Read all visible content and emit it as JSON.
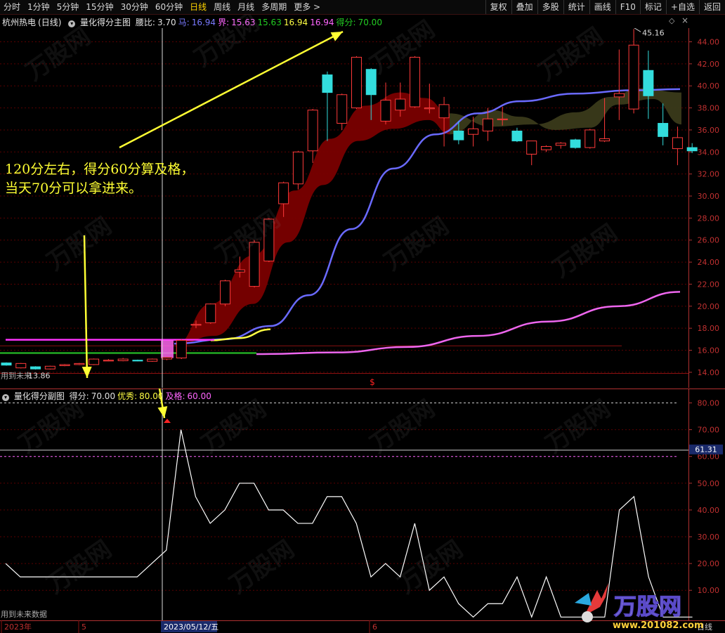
{
  "toolbar": {
    "periods": [
      "分时",
      "1分钟",
      "5分钟",
      "15分钟",
      "30分钟",
      "60分钟",
      "日线",
      "周线",
      "月线",
      "多周期",
      "更多 >"
    ],
    "active_period": "日线",
    "buttons": [
      "复权",
      "叠加",
      "多股",
      "统计",
      "画线",
      "F10",
      "标记",
      "+自选",
      "返回"
    ]
  },
  "main_panel": {
    "stock": "杭州热电",
    "period_label": "(日线)",
    "indicator": "量化得分主图",
    "legend": [
      {
        "k": "腰比",
        "v": "3.70",
        "color": "#e0e0e0"
      },
      {
        "k": "马",
        "v": "16.94",
        "color": "#7a7aff"
      },
      {
        "k": "界",
        "v": "15.63",
        "color": "#ff66ff"
      },
      {
        "k": "",
        "v": "15.63",
        "color": "#22cc22"
      },
      {
        "k": "",
        "v": "16.94",
        "color": "#ffff44"
      },
      {
        "k": "",
        "v": "16.94",
        "color": "#ff66ff"
      },
      {
        "k": "得分",
        "v": "70.00",
        "color": "#22cc22"
      }
    ],
    "y_ticks": [
      "44.00",
      "42.00",
      "40.00",
      "38.00",
      "36.00",
      "34.00",
      "32.00",
      "30.00",
      "28.00",
      "26.00",
      "24.00",
      "22.00",
      "20.00",
      "18.00",
      "16.00",
      "14.00"
    ],
    "high_label": "45.16",
    "low_label": "13.86",
    "future_note": "用到未来",
    "s_marker": "$"
  },
  "sub_panel": {
    "indicator": "量化得分副图",
    "legend": [
      {
        "k": "得分",
        "v": "70.00",
        "color": "#e0e0e0"
      },
      {
        "k": "优秀",
        "v": "80.00",
        "color": "#ffff44"
      },
      {
        "k": "及格",
        "v": "60.00",
        "color": "#ff66ff"
      }
    ],
    "y_ticks": [
      "80.00",
      "70.00",
      "60.00",
      "50.00",
      "40.00",
      "30.00",
      "20.00",
      "10.00"
    ],
    "cursor_value": "61.31",
    "future_note": "用到未来数据"
  },
  "x_axis": {
    "labels": [
      "2023年",
      "5",
      "6"
    ],
    "cursor_date": "2023/05/12/五",
    "period_tag": "日线"
  },
  "annotation": {
    "line1": "120分左右，得分60分算及格，",
    "line2": "当天70分可以拿进来。"
  },
  "watermark": {
    "brand": "万股网",
    "url": "www.201082.com"
  },
  "candles": [
    {
      "o": 14.85,
      "c": 14.65,
      "h": 14.9,
      "l": 14.6
    },
    {
      "o": 14.4,
      "c": 14.8,
      "h": 14.85,
      "l": 14.35
    },
    {
      "o": 14.5,
      "c": 14.3,
      "h": 14.55,
      "l": 14.25
    },
    {
      "o": 14.3,
      "c": 14.55,
      "h": 14.6,
      "l": 14.25
    },
    {
      "o": 14.6,
      "c": 14.7,
      "h": 14.75,
      "l": 14.55
    },
    {
      "o": 14.7,
      "c": 14.8,
      "h": 14.85,
      "l": 14.65
    },
    {
      "o": 14.7,
      "c": 15.2,
      "h": 15.25,
      "l": 14.65
    },
    {
      "o": 15.1,
      "c": 15.1,
      "h": 15.2,
      "l": 15.0
    },
    {
      "o": 15.05,
      "c": 15.2,
      "h": 15.3,
      "l": 15.0
    },
    {
      "o": 15.1,
      "c": 15.05,
      "h": 15.15,
      "l": 15.0
    },
    {
      "o": 15.0,
      "c": 15.2,
      "h": 15.25,
      "l": 14.95
    },
    {
      "o": 15.2,
      "c": 15.35,
      "h": 15.4,
      "l": 15.1
    },
    {
      "o": 15.3,
      "c": 16.9,
      "h": 17.0,
      "l": 15.2
    },
    {
      "o": 18.3,
      "c": 18.35,
      "h": 18.7,
      "l": 18.0
    },
    {
      "o": 18.5,
      "c": 20.2,
      "h": 20.25,
      "l": 18.4
    },
    {
      "o": 20.2,
      "c": 22.3,
      "h": 22.4,
      "l": 20.0
    },
    {
      "o": 23.1,
      "c": 23.3,
      "h": 24.5,
      "l": 22.6
    },
    {
      "o": 21.8,
      "c": 25.8,
      "h": 26.0,
      "l": 21.7
    },
    {
      "o": 24.1,
      "c": 27.9,
      "h": 28.0,
      "l": 24.0
    },
    {
      "o": 29.3,
      "c": 31.2,
      "h": 31.3,
      "l": 28.1
    },
    {
      "o": 31.1,
      "c": 34.0,
      "h": 34.1,
      "l": 30.6
    },
    {
      "o": 34.1,
      "c": 37.8,
      "h": 37.9,
      "l": 33.0
    },
    {
      "o": 41.0,
      "c": 39.4,
      "h": 41.3,
      "l": 35.0
    },
    {
      "o": 36.6,
      "c": 39.2,
      "h": 39.3,
      "l": 36.0
    },
    {
      "o": 38.0,
      "c": 42.6,
      "h": 42.7,
      "l": 37.9
    },
    {
      "o": 41.5,
      "c": 39.2,
      "h": 41.6,
      "l": 36.9
    },
    {
      "o": 36.8,
      "c": 38.7,
      "h": 40.3,
      "l": 36.5
    },
    {
      "o": 37.8,
      "c": 38.8,
      "h": 40.3,
      "l": 37.2
    },
    {
      "o": 38.1,
      "c": 42.6,
      "h": 42.7,
      "l": 38.0
    },
    {
      "o": 38.0,
      "c": 38.0,
      "h": 40.2,
      "l": 37.5
    },
    {
      "o": 37.1,
      "c": 38.3,
      "h": 39.0,
      "l": 34.5
    },
    {
      "o": 35.9,
      "c": 35.1,
      "h": 36.8,
      "l": 34.7
    },
    {
      "o": 35.6,
      "c": 36.1,
      "h": 37.2,
      "l": 34.5
    },
    {
      "o": 35.9,
      "c": 37.0,
      "h": 38.0,
      "l": 35.0
    },
    {
      "o": 37.0,
      "c": 37.0,
      "h": 38.1,
      "l": 36.4
    },
    {
      "o": 35.9,
      "c": 35.0,
      "h": 36.2,
      "l": 34.9
    },
    {
      "o": 33.8,
      "c": 35.0,
      "h": 35.0,
      "l": 32.8
    },
    {
      "o": 34.2,
      "c": 34.5,
      "h": 34.6,
      "l": 34.0
    },
    {
      "o": 34.6,
      "c": 34.8,
      "h": 34.9,
      "l": 34.3
    },
    {
      "o": 35.1,
      "c": 34.4,
      "h": 35.2,
      "l": 34.3
    },
    {
      "o": 34.4,
      "c": 36.0,
      "h": 36.1,
      "l": 34.3
    },
    {
      "o": 35.0,
      "c": 35.2,
      "h": 38.9,
      "l": 34.9
    },
    {
      "o": 39.0,
      "c": 39.3,
      "h": 43.3,
      "l": 36.9
    },
    {
      "o": 37.9,
      "c": 43.7,
      "h": 45.16,
      "l": 37.5
    },
    {
      "o": 41.4,
      "c": 39.1,
      "h": 43.2,
      "l": 37.0
    },
    {
      "o": 36.6,
      "c": 35.4,
      "h": 38.4,
      "l": 34.6
    },
    {
      "o": 34.3,
      "c": 35.3,
      "h": 36.3,
      "l": 32.8
    },
    {
      "o": 34.4,
      "c": 34.1,
      "h": 34.8,
      "l": 33.9
    }
  ],
  "score_series": [
    20,
    15,
    15,
    15,
    15,
    15,
    15,
    15,
    15,
    15,
    20,
    25,
    70,
    45,
    35,
    40,
    50,
    50,
    40,
    40,
    35,
    35,
    45,
    45,
    35,
    15,
    20,
    15,
    35,
    10,
    15,
    5,
    0,
    5,
    5,
    15,
    0,
    15,
    0,
    0,
    0,
    0,
    40,
    45,
    15,
    0,
    0,
    0
  ]
}
